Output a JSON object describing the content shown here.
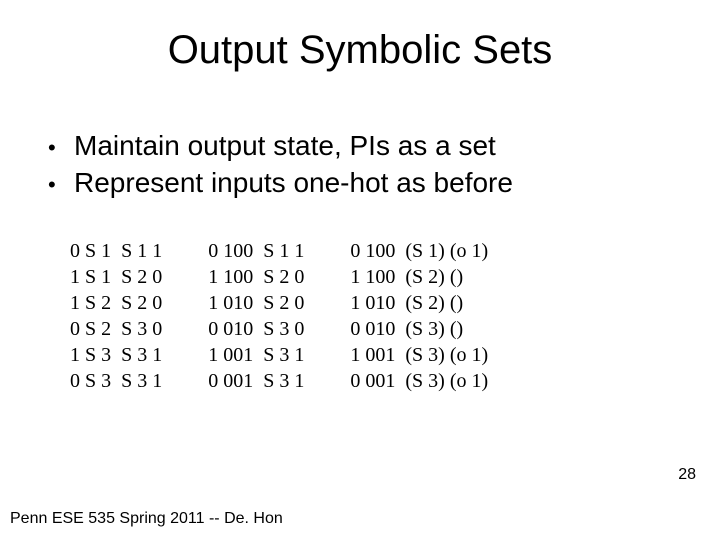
{
  "title": "Output Symbolic Sets",
  "bullets": [
    "Maintain output state, PIs as a set",
    "Represent inputs one-hot as before"
  ],
  "table1": [
    [
      "0 S 1",
      "S 1 1"
    ],
    [
      "1 S 1",
      "S 2 0"
    ],
    [
      "1 S 2",
      "S 2 0"
    ],
    [
      "0 S 2",
      "S 3 0"
    ],
    [
      "1 S 3",
      "S 3 1"
    ],
    [
      "0 S 3",
      "S 3 1"
    ]
  ],
  "table2": [
    [
      "0 100",
      "S 1 1"
    ],
    [
      "1 100",
      "S 2 0"
    ],
    [
      "1 010",
      "S 2 0"
    ],
    [
      "0 010",
      "S 3 0"
    ],
    [
      "1 001",
      "S 3 1"
    ],
    [
      "0 001",
      "S 3 1"
    ]
  ],
  "table3": [
    [
      "0 100",
      "(S 1) (o 1)"
    ],
    [
      "1 100",
      "(S 2) ()"
    ],
    [
      "1 010",
      "(S 2) ()"
    ],
    [
      "0 010",
      "(S 3) ()"
    ],
    [
      "1 001",
      "(S 3) (o 1)"
    ],
    [
      "0 001",
      "(S 3) (o 1)"
    ]
  ],
  "page_number": "28",
  "footer": "Penn ESE 535 Spring 2011 -- De. Hon"
}
